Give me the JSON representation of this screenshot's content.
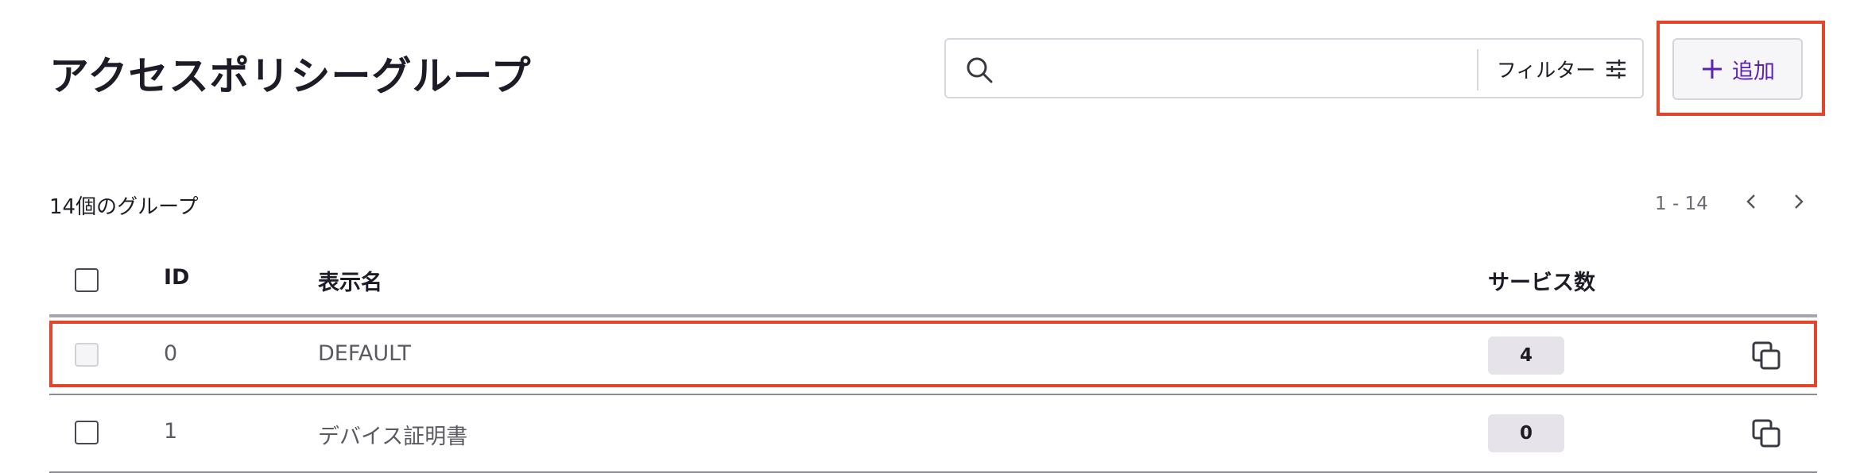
{
  "header": {
    "title": "アクセスポリシーグループ",
    "search_placeholder": "",
    "filter_label": "フィルター",
    "add_label": "追加"
  },
  "summary": {
    "count_label": "14個のグループ",
    "page_range": "1 - 14"
  },
  "table": {
    "columns": {
      "id": "ID",
      "name": "表示名",
      "services": "サービス数"
    },
    "rows": [
      {
        "id": "0",
        "name": "DEFAULT",
        "services": "4",
        "checkbox_disabled": true
      },
      {
        "id": "1",
        "name": "デバイス証明書",
        "services": "0",
        "checkbox_disabled": false
      }
    ]
  },
  "icons": {
    "search": "search-icon",
    "filter": "sliders-icon",
    "add": "plus-icon",
    "prev": "chevron-left-icon",
    "next": "chevron-right-icon",
    "copy": "copy-icon"
  },
  "colors": {
    "accent": "#5a22b7",
    "highlight": "#e2452c",
    "badge_bg": "#e6e4ea"
  }
}
